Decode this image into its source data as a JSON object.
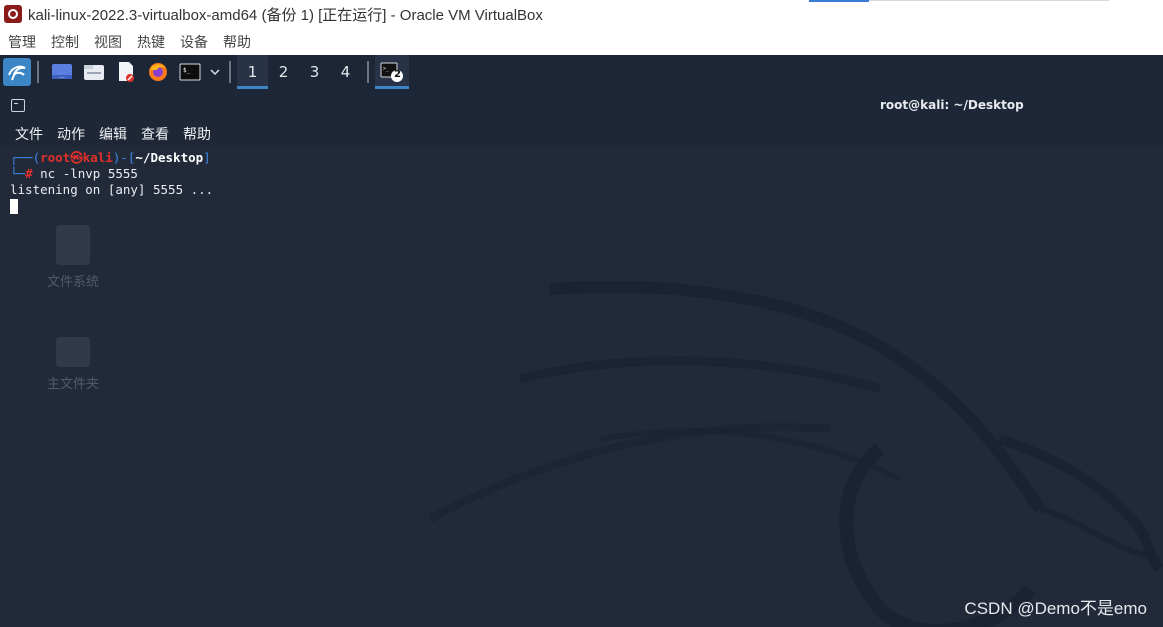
{
  "window": {
    "title": "kali-linux-2022.3-virtualbox-amd64 (备份 1) [正在运行] - Oracle VM VirtualBox",
    "menu": [
      "管理",
      "控制",
      "视图",
      "热键",
      "设备",
      "帮助"
    ]
  },
  "panel": {
    "workspaces": [
      "1",
      "2",
      "3",
      "4"
    ],
    "active_workspace": "1",
    "task_badge": "2",
    "icons": [
      "kali-menu-icon",
      "desktop-icon",
      "file-manager-icon",
      "text-editor-icon",
      "firefox-icon",
      "terminal-icon",
      "dropdown-chevron-icon"
    ]
  },
  "desktop": {
    "icons": [
      {
        "label": "文件系统"
      },
      {
        "label": "主文件夹"
      }
    ]
  },
  "terminal": {
    "title": "root@kali: ~/Desktop",
    "menu": [
      "文件",
      "动作",
      "编辑",
      "查看",
      "帮助"
    ],
    "prompt": {
      "box_start": "┌──(",
      "user": "root",
      "at": "㉿",
      "host": "kali",
      "mid": ")-[",
      "path": "~/Desktop",
      "end": "]",
      "box_end": "└─",
      "hash": "#"
    },
    "command": "nc -lnvp 5555",
    "output": "listening on [any] 5555 ..."
  },
  "watermark": "CSDN @Demo不是emo",
  "colors": {
    "panel_bg": "#1d2636",
    "desktop_bg": "#222a3a",
    "accent": "#3d86c6",
    "prompt_red": "#e0302a",
    "prompt_blue": "#3d86e6"
  }
}
